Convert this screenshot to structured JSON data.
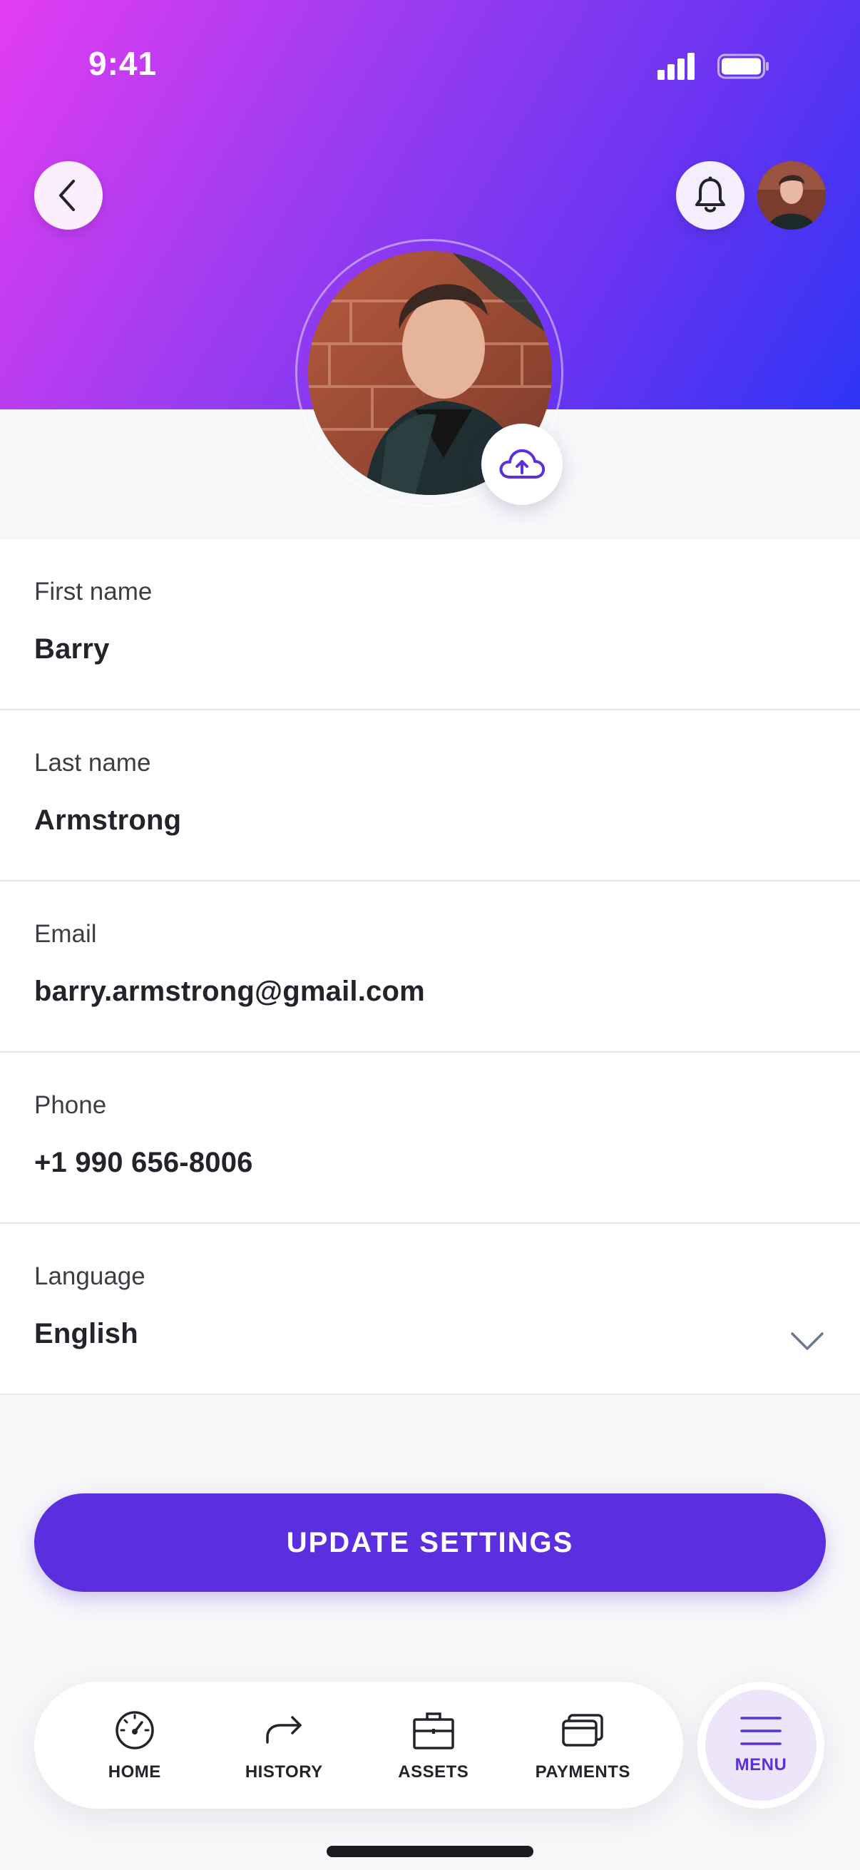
{
  "status_bar": {
    "time": "9:41"
  },
  "profile": {
    "fields": [
      {
        "label": "First name",
        "value": "Barry"
      },
      {
        "label": "Last name",
        "value": "Armstrong"
      },
      {
        "label": "Email",
        "value": "barry.armstrong@gmail.com"
      },
      {
        "label": "Phone",
        "value": "+1 990 656-8006"
      },
      {
        "label": "Language",
        "value": "English"
      }
    ]
  },
  "actions": {
    "update_label": "UPDATE SETTINGS"
  },
  "tab_bar": {
    "items": [
      {
        "label": "HOME",
        "icon": "speedometer-icon"
      },
      {
        "label": "HISTORY",
        "icon": "redo-arrow-icon"
      },
      {
        "label": "ASSETS",
        "icon": "briefcase-icon"
      },
      {
        "label": "PAYMENTS",
        "icon": "cards-icon"
      }
    ],
    "menu_label": "MENU"
  },
  "colors": {
    "accent": "#5b2ee0",
    "header_gradient": [
      "#e33df2",
      "#6a34f2",
      "#2e35f5"
    ]
  }
}
